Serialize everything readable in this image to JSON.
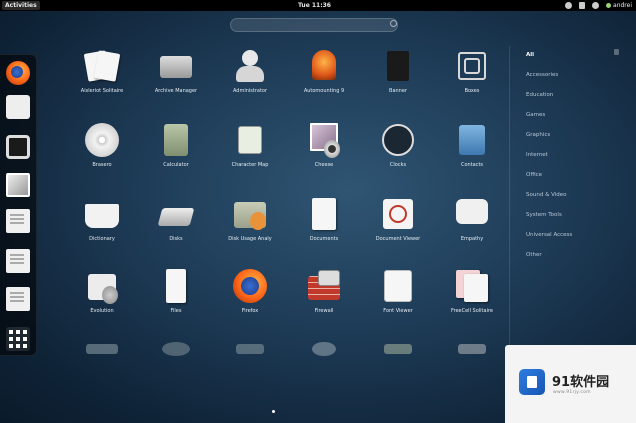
{
  "topbar": {
    "activities_label": "Activities",
    "clock": "Tue 11:36",
    "user": "andrei"
  },
  "search": {
    "placeholder": ""
  },
  "apps": [
    {
      "label": "Aisleriot Solitaire",
      "icon": "cards-icon"
    },
    {
      "label": "Archive Manager",
      "icon": "archive-icon"
    },
    {
      "label": "Administrator",
      "icon": "user-icon"
    },
    {
      "label": "Automounting 9",
      "icon": "alarm-icon"
    },
    {
      "label": "Banner",
      "icon": "banner-icon"
    },
    {
      "label": "Boxes",
      "icon": "cube-icon"
    },
    {
      "label": "Brasero",
      "icon": "disc-icon"
    },
    {
      "label": "Calculator",
      "icon": "calculator-icon"
    },
    {
      "label": "Character Map",
      "icon": "charmap-icon"
    },
    {
      "label": "Cheese",
      "icon": "camera-icon"
    },
    {
      "label": "Clocks",
      "icon": "clock-icon"
    },
    {
      "label": "Contacts",
      "icon": "contacts-icon"
    },
    {
      "label": "Dictionary",
      "icon": "book-icon"
    },
    {
      "label": "Disks",
      "icon": "disks-icon"
    },
    {
      "label": "Disk Usage Analy",
      "icon": "folder-icon"
    },
    {
      "label": "Documents",
      "icon": "documents-icon"
    },
    {
      "label": "Document Viewer",
      "icon": "document-viewer-icon"
    },
    {
      "label": "Empathy",
      "icon": "chat-icon"
    },
    {
      "label": "Evolution",
      "icon": "mail-icon"
    },
    {
      "label": "Files",
      "icon": "files-icon"
    },
    {
      "label": "Firefox",
      "icon": "firefox-icon"
    },
    {
      "label": "Firewall",
      "icon": "firewall-icon"
    },
    {
      "label": "Font Viewer",
      "icon": "font-icon"
    },
    {
      "label": "FreeCell Solitaire",
      "icon": "freecell-icon"
    }
  ],
  "categories": [
    {
      "label": "All"
    },
    {
      "label": "Accessories"
    },
    {
      "label": "Education"
    },
    {
      "label": "Games"
    },
    {
      "label": "Graphics"
    },
    {
      "label": "Internet"
    },
    {
      "label": "Office"
    },
    {
      "label": "Sound & Video"
    },
    {
      "label": "System Tools"
    },
    {
      "label": "Universal Access"
    },
    {
      "label": "Other"
    }
  ],
  "watermark": {
    "text": "91软件园",
    "sub": "www.91rjy.com"
  },
  "colors": {
    "accent": "#2f7de0",
    "background": "#1d3a55",
    "topbar": "#000000"
  }
}
